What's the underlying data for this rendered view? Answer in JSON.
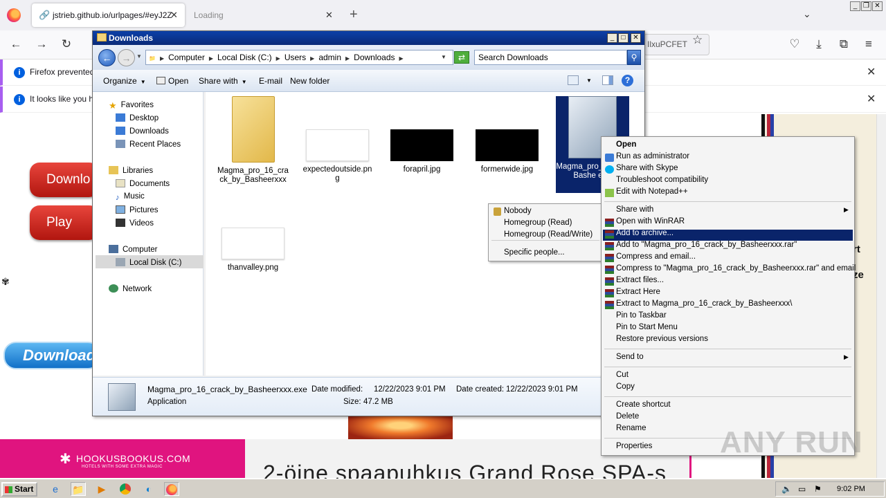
{
  "browser": {
    "tabs": [
      {
        "label": "jstrieb.github.io/urlpages/#eyJ2Z",
        "close": "✕"
      },
      {
        "label": "Loading",
        "close": "✕"
      }
    ],
    "new_tab": "+",
    "url_tail": "IlxuPCFET",
    "notifications": [
      {
        "text": "Firefox prevented",
        "close": "✕"
      },
      {
        "text": "It looks like you ha",
        "close": "✕"
      }
    ]
  },
  "website": {
    "red_buttons": [
      "Downlo",
      "Play"
    ],
    "blue_button": "Download",
    "ad_text": [
      "rt",
      "ze"
    ],
    "hook_title": "HOOKUSBOOKUS.COM",
    "hook_sub": "HOTELS WITH SOME EXTRA MAGIC",
    "spa_text": "2-öine spaapuhkus Grand Rose SPA-s"
  },
  "explorer": {
    "title": "Downloads",
    "breadcrumb": [
      "Computer",
      "Local Disk (C:)",
      "Users",
      "admin",
      "Downloads"
    ],
    "search_placeholder": "Search Downloads",
    "toolbar": [
      "Organize",
      "Open",
      "Share with",
      "E-mail",
      "New folder"
    ],
    "nav": {
      "favorites": {
        "label": "Favorites",
        "items": [
          "Desktop",
          "Downloads",
          "Recent Places"
        ]
      },
      "libraries": {
        "label": "Libraries",
        "items": [
          "Documents",
          "Music",
          "Pictures",
          "Videos"
        ]
      },
      "computer": {
        "label": "Computer",
        "items": [
          "Local Disk (C:)"
        ]
      },
      "network": "Network"
    },
    "files": [
      {
        "name": "Magma_pro_16_crack_by_Basheerxxx",
        "kind": "folder"
      },
      {
        "name": "expectedoutside.png",
        "kind": "white-thumb"
      },
      {
        "name": "forapril.jpg",
        "kind": "black-thumb"
      },
      {
        "name": "formerwide.jpg",
        "kind": "black-thumb"
      },
      {
        "name": "Magma_pro_16_crack_by_Basheerxxx.exe",
        "name_visible": "Magma_pro_ck_by_Bashe exe",
        "kind": "installer"
      },
      {
        "name": "thanvalley.png",
        "kind": "white-thumb"
      }
    ],
    "details": {
      "filename": "Magma_pro_16_crack_by_Basheerxxx.exe",
      "type": "Application",
      "modified_label": "Date modified:",
      "modified": "12/22/2023 9:01 PM",
      "created_label": "Date created:",
      "created": "12/22/2023 9:01 PM",
      "size_label": "Size:",
      "size": "47.2 MB"
    }
  },
  "share_menu": [
    "Nobody",
    "Homegroup (Read)",
    "Homegroup (Read/Write)",
    "Specific people..."
  ],
  "context_menu": {
    "open": "Open",
    "run_admin": "Run as administrator",
    "skype": "Share with Skype",
    "troubleshoot": "Troubleshoot compatibility",
    "notepad": "Edit with Notepad++",
    "share_with": "Share with",
    "open_winrar": "Open with WinRAR",
    "add_archive": "Add to archive...",
    "add_rar": "Add to \"Magma_pro_16_crack_by_Basheerxxx.rar\"",
    "compress_email": "Compress and email...",
    "compress_rar_email": "Compress to \"Magma_pro_16_crack_by_Basheerxxx.rar\" and email",
    "extract_files": "Extract files...",
    "extract_here": "Extract Here",
    "extract_to": "Extract to Magma_pro_16_crack_by_Basheerxxx\\",
    "pin_taskbar": "Pin to Taskbar",
    "pin_start": "Pin to Start Menu",
    "restore": "Restore previous versions",
    "send_to": "Send to",
    "cut": "Cut",
    "copy": "Copy",
    "create_shortcut": "Create shortcut",
    "delete": "Delete",
    "rename": "Rename",
    "properties": "Properties"
  },
  "taskbar": {
    "start": "Start",
    "clock": "9:02 PM"
  },
  "watermark": "ANY RUN"
}
